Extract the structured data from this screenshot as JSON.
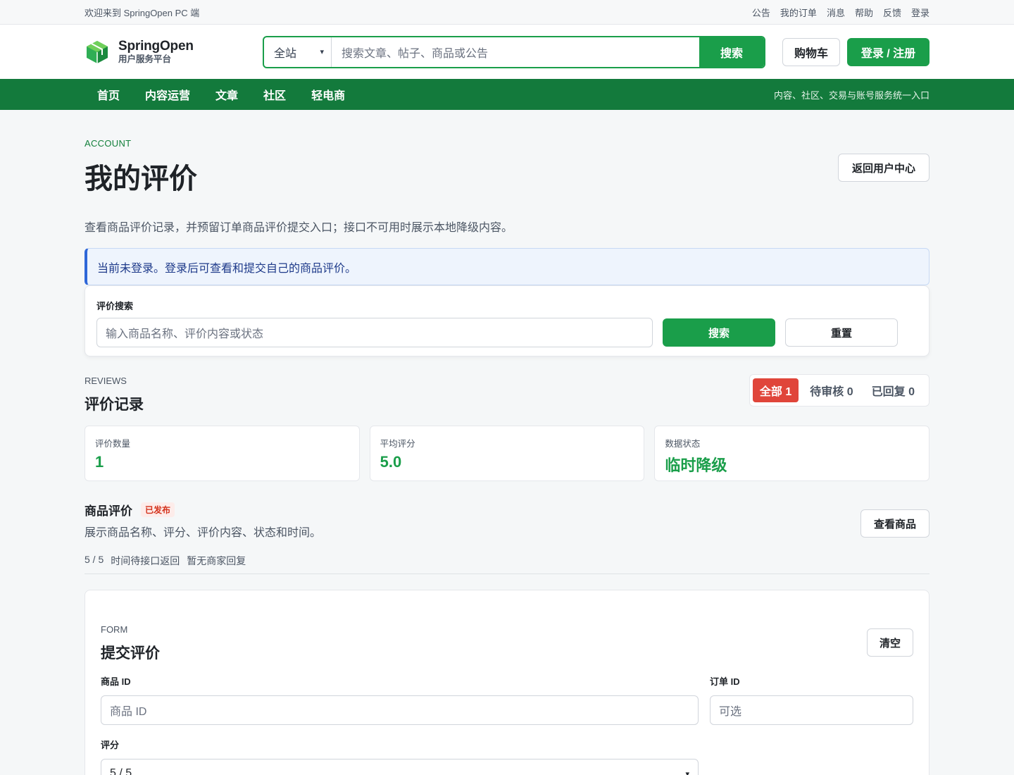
{
  "topbar": {
    "welcome": "欢迎来到 SpringOpen PC 端",
    "links": [
      "公告",
      "我的订单",
      "消息",
      "帮助",
      "反馈",
      "登录"
    ]
  },
  "header": {
    "brand": "SpringOpen",
    "subtitle": "用户服务平台",
    "search_scope": "全站",
    "search_placeholder": "搜索文章、帖子、商品或公告",
    "search_button": "搜索",
    "cart": "购物车",
    "login": "登录 / 注册"
  },
  "nav": {
    "items": [
      "首页",
      "内容运营",
      "文章",
      "社区",
      "轻电商"
    ],
    "tagline": "内容、社区、交易与账号服务统一入口"
  },
  "page": {
    "eyebrow": "ACCOUNT",
    "title": "我的评价",
    "back_button": "返回用户中心",
    "description": "查看商品评价记录，并预留订单商品评价提交入口；接口不可用时展示本地降级内容。",
    "alert": "当前未登录。登录后可查看和提交自己的商品评价。"
  },
  "search_card": {
    "label": "评价搜索",
    "placeholder": "输入商品名称、评价内容或状态",
    "search": "搜索",
    "reset": "重置"
  },
  "reviews": {
    "eyebrow": "REVIEWS",
    "title": "评价记录",
    "tabs": [
      "全部 1",
      "待审核 0",
      "已回复 0"
    ],
    "stats": [
      {
        "label": "评价数量",
        "value": "1"
      },
      {
        "label": "平均评分",
        "value": "5.0"
      },
      {
        "label": "数据状态",
        "value": "临时降级"
      }
    ],
    "item": {
      "title": "商品评价",
      "badge": "已发布",
      "desc": "展示商品名称、评分、评价内容、状态和时间。",
      "meta": [
        "5 / 5",
        "时间待接口返回",
        "暂无商家回复"
      ],
      "view": "查看商品"
    }
  },
  "form": {
    "eyebrow": "FORM",
    "title": "提交评价",
    "clear": "清空",
    "product_label": "商品 ID",
    "product_placeholder": "商品 ID",
    "order_label": "订单 ID",
    "order_placeholder": "可选",
    "rating_label": "评分",
    "rating_value": "5 / 5"
  },
  "colors": {
    "primary": "#1a9e4a",
    "nav": "#137a3c",
    "danger": "#e0453a",
    "info": "#2f67d8"
  }
}
